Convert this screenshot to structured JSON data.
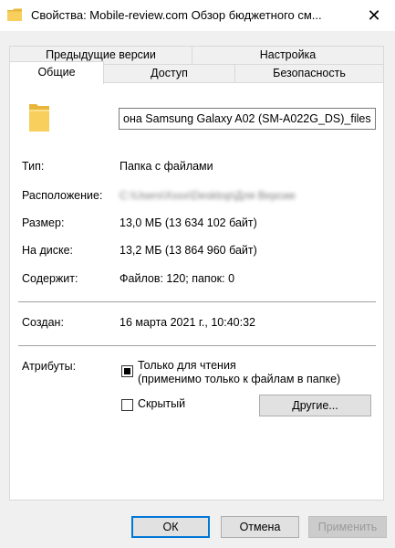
{
  "window": {
    "title": "Свойства: Mobile-review.com Обзор бюджетного см..."
  },
  "tabs": {
    "previous_versions": "Предыдущие версии",
    "settings": "Настройка",
    "general": "Общие",
    "access": "Доступ",
    "security": "Безопасность"
  },
  "general": {
    "folder_name": "она Samsung Galaxy A02 (SM-A022G_DS)_files",
    "type_label": "Тип:",
    "type_value": "Папка с файлами",
    "location_label": "Расположение:",
    "location_value": "C:\\Users\\Xxxx\\Desktop\\Для Версии",
    "size_label": "Размер:",
    "size_value": "13,0 МБ (13 634 102 байт)",
    "ondisk_label": "На диске:",
    "ondisk_value": "13,2 МБ (13 864 960 байт)",
    "contains_label": "Содержит:",
    "contains_value": "Файлов: 120; папок: 0",
    "created_label": "Создан:",
    "created_value": "16 марта 2021 г., 10:40:32",
    "attributes_label": "Атрибуты:",
    "readonly_line1": "Только для чтения",
    "readonly_line2": "(применимо только к файлам в папке)",
    "hidden_label": "Скрытый",
    "other_button": "Другие..."
  },
  "buttons": {
    "ok": "ОК",
    "cancel": "Отмена",
    "apply": "Применить"
  },
  "colors": {
    "accent": "#0078d7",
    "folder": "#f8cf5c"
  }
}
